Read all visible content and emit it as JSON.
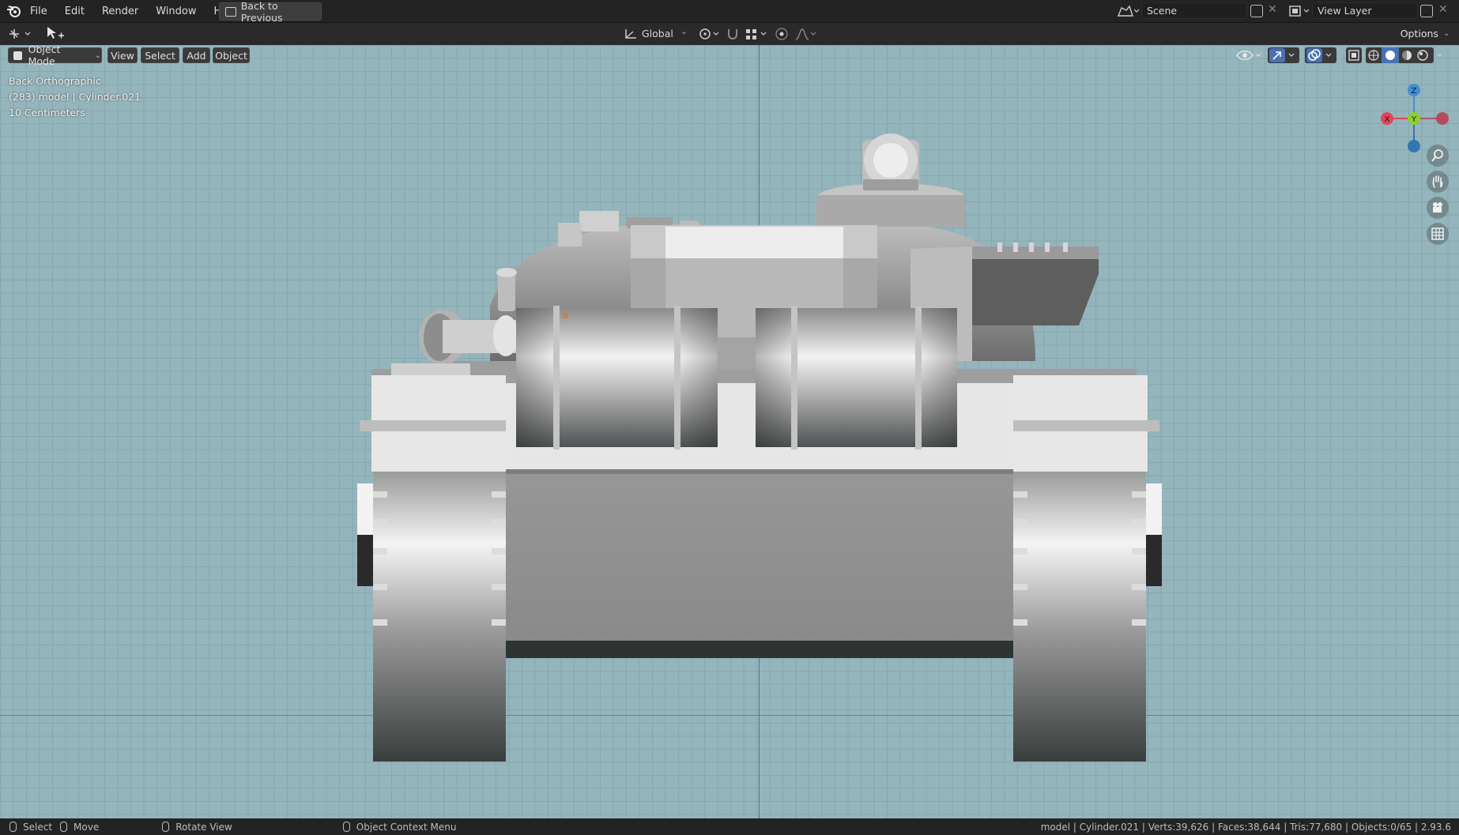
{
  "menu": {
    "items": [
      "File",
      "Edit",
      "Render",
      "Window",
      "Help"
    ],
    "back_to_previous": "Back to Previous"
  },
  "scene": {
    "name": "Scene",
    "view_layer": "View Layer"
  },
  "toolbar": {
    "transform_orientation": "Global",
    "options": "Options"
  },
  "viewport_header": {
    "mode": "Object Mode",
    "view": "View",
    "select": "Select",
    "add": "Add",
    "object": "Object"
  },
  "overlay": {
    "view_name": "Back Orthographic",
    "object_info": "(283) model | Cylinder.021",
    "scale": "10 Centimeters"
  },
  "gizmo": {
    "z": "Z",
    "x": "X",
    "y": "Y"
  },
  "statusbar": {
    "select": "Select",
    "move": "Move",
    "rotate_view": "Rotate View",
    "context_menu": "Object Context Menu",
    "stats": "model | Cylinder.021 | Verts:39,626 | Faces:38,644 | Tris:77,680 | Objects:0/65 | 2.93.6"
  },
  "colors": {
    "viewport_bg": "#94b5bc",
    "grid": "#86a7ae",
    "axis_x": "#b46464",
    "axis_y": "#4a6fa8",
    "gizmo_x": "#e0455a",
    "gizmo_y": "#8ccf2e",
    "gizmo_z": "#3f8fd4"
  }
}
